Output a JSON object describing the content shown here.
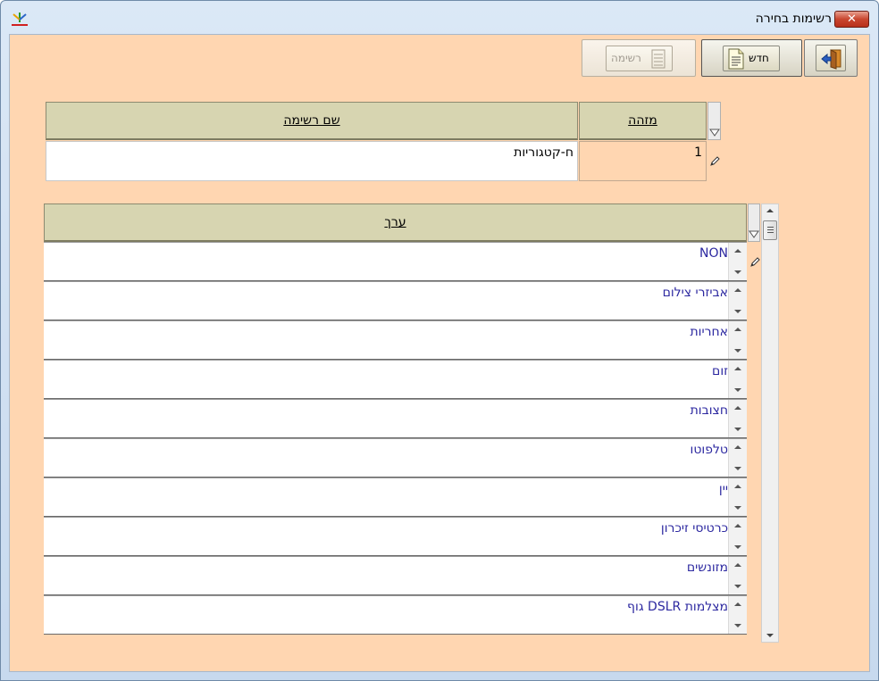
{
  "window": {
    "title": "רשימות בחירה",
    "close_label": "✕"
  },
  "toolbar": {
    "new_label": "חדש",
    "list_label": "רשימה"
  },
  "list_header": {
    "id_column": "מזהה",
    "name_column": "שם רשימה"
  },
  "list_record": {
    "id": "1",
    "name": "ח-קטגוריות"
  },
  "values_grid": {
    "column": "ערך",
    "rows": [
      "NON",
      "אביזרי צילום",
      "אחריות",
      "זום",
      "חצובות",
      "טלפוטו",
      "יין",
      "כרטיסי זיכרון",
      "מזונשים",
      "מצלמות DSLR גוף"
    ]
  }
}
